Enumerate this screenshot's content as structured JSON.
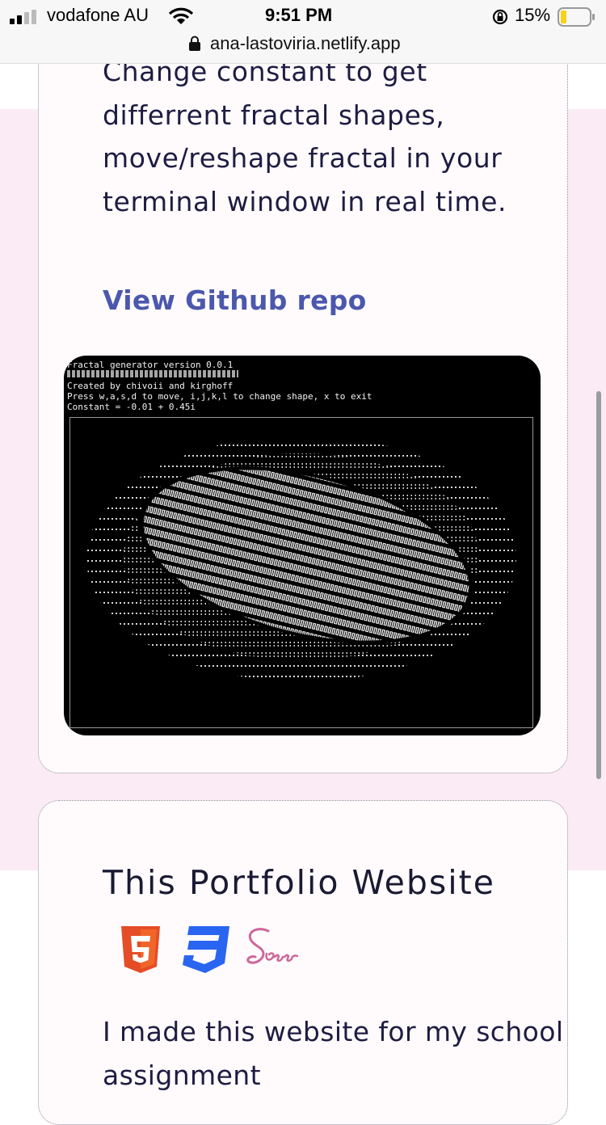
{
  "status_bar": {
    "carrier": "vodafone AU",
    "time": "9:51 PM",
    "battery_percent": "15%",
    "url": "ana-lastoviria.netlify.app"
  },
  "project_card": {
    "description": "Change constant to get differrent fractal shapes, move/reshape fractal in your terminal window in real time.",
    "link_label": "View Github repo",
    "terminal": {
      "line1": "Fractal generator version 0.0.1",
      "line2": "Created by chivoii and kirghoff",
      "line3": "Press w,a,s,d to move, i,j,k,l to change shape, x to exit",
      "line4": "Constant = -0.01 + 0.45i"
    }
  },
  "portfolio_card": {
    "title": "This Portfolio Website",
    "tech_icons": [
      "html5-icon",
      "css3-icon",
      "sass-icon"
    ],
    "description": "I made this website for my school assignment"
  },
  "colors": {
    "page_background": "#fbebf4",
    "card_background": "#fffbfd",
    "link": "#4c58ad",
    "text": "#1e1c42",
    "html5": "#e44d26",
    "css3": "#2965f1",
    "sass": "#cd6799"
  }
}
